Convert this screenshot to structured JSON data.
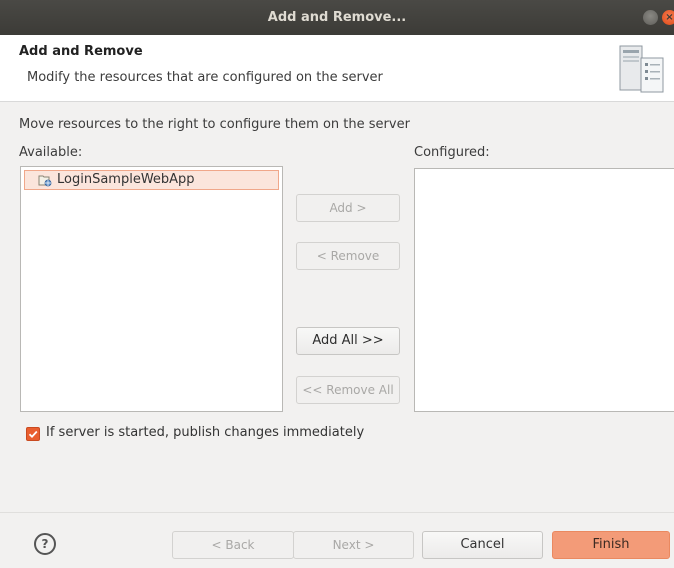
{
  "window": {
    "title": "Add and Remove...",
    "close_glyph": "×"
  },
  "header": {
    "title": "Add and Remove",
    "description": "Modify the resources that are configured on the server",
    "icon": "server-icon"
  },
  "main": {
    "instruction": "Move resources to the right to configure them on the server",
    "available_label": "Available:",
    "configured_label": "Configured:",
    "available_items": [
      {
        "label": "LoginSampleWebApp",
        "icon": "web-project-icon",
        "selected": true
      }
    ],
    "configured_items": []
  },
  "actions": {
    "add": "Add >",
    "remove": "< Remove",
    "add_all": "Add All >>",
    "remove_all": "<< Remove All"
  },
  "option": {
    "label": "If server is started, publish changes immediately",
    "checked": true
  },
  "footer": {
    "help_glyph": "?",
    "back": "< Back",
    "next": "Next >",
    "cancel": "Cancel",
    "finish": "Finish"
  },
  "colors": {
    "accent": "#e95e2f",
    "finish_button": "#f39b78",
    "titlebar": "#3c3b37"
  }
}
